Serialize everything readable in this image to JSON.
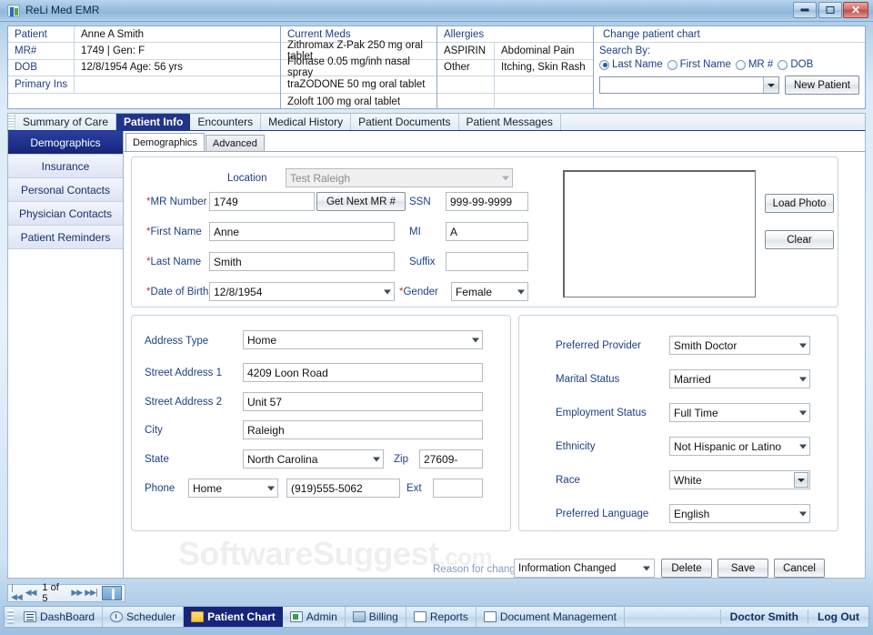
{
  "window": {
    "title": "ReLi Med EMR",
    "minimize": "–",
    "maximize": "❐",
    "close": "✕"
  },
  "patient_header": {
    "rows": [
      {
        "label": "Patient",
        "value": "Anne A Smith"
      },
      {
        "label": "MR#",
        "value": "1749 | Gen: F"
      },
      {
        "label": "DOB",
        "value": "12/8/1954  Age: 56 yrs"
      },
      {
        "label": "Primary Ins",
        "value": ""
      }
    ]
  },
  "current_meds": {
    "header": "Current Meds",
    "items": [
      "Zithromax Z-Pak 250 mg oral tablet",
      "Flonase 0.05 mg/inh nasal spray",
      "traZODONE 50 mg oral tablet",
      "Zoloft 100 mg oral tablet"
    ]
  },
  "allergies": {
    "header": "Allergies",
    "rows": [
      {
        "allergen": "ASPIRIN",
        "reaction": "Abdominal Pain"
      },
      {
        "allergen": "Other",
        "reaction": "Itching, Skin Rash"
      }
    ]
  },
  "change_patient_chart": {
    "title": "Change patient chart",
    "search_by_label": "Search By:",
    "options": [
      {
        "label": "Last Name",
        "selected": true
      },
      {
        "label": "First Name",
        "selected": false
      },
      {
        "label": "MR #",
        "selected": false
      },
      {
        "label": "DOB",
        "selected": false
      }
    ],
    "search_value": "",
    "new_patient_label": "New Patient"
  },
  "main_tabs": [
    {
      "label": "Summary of Care",
      "active": false
    },
    {
      "label": "Patient Info",
      "active": true
    },
    {
      "label": "Encounters",
      "active": false
    },
    {
      "label": "Medical History",
      "active": false
    },
    {
      "label": "Patient Documents",
      "active": false
    },
    {
      "label": "Patient Messages",
      "active": false
    }
  ],
  "sidebar": {
    "items": [
      {
        "label": "Demographics",
        "active": true
      },
      {
        "label": "Insurance",
        "active": false
      },
      {
        "label": "Personal Contacts",
        "active": false
      },
      {
        "label": "Physician Contacts",
        "active": false
      },
      {
        "label": "Patient Reminders",
        "active": false
      }
    ]
  },
  "sub_tabs": [
    {
      "label": "Demographics",
      "active": true
    },
    {
      "label": "Advanced",
      "active": false
    }
  ],
  "demographics": {
    "location_label": "Location",
    "location_value": "Test Raleigh",
    "mr_number_label": "MR Number",
    "mr_number_value": "1749",
    "get_next_mr_label": "Get Next MR #",
    "ssn_label": "SSN",
    "ssn_value": "999-99-9999",
    "first_name_label": "First Name",
    "first_name_value": "Anne",
    "mi_label": "MI",
    "mi_value": "A",
    "last_name_label": "Last Name",
    "last_name_value": "Smith",
    "suffix_label": "Suffix",
    "suffix_value": "",
    "dob_label": "Date of Birth",
    "dob_value": "12/8/1954",
    "gender_label": "Gender",
    "gender_value": "Female",
    "load_photo_label": "Load Photo",
    "clear_label": "Clear",
    "required_marker": "*"
  },
  "address": {
    "address_type_label": "Address Type",
    "address_type_value": "Home",
    "street1_label": "Street Address 1",
    "street1_value": "4209 Loon Road",
    "street2_label": "Street Address 2",
    "street2_value": "Unit 57",
    "city_label": "City",
    "city_value": "Raleigh",
    "state_label": "State",
    "state_value": "North Carolina",
    "zip_label": "Zip",
    "zip_value": "27609-",
    "phone_label": "Phone",
    "phone_type_value": "Home",
    "phone_value": "(919)555-5062",
    "ext_label": "Ext",
    "ext_value": ""
  },
  "details": {
    "preferred_provider_label": "Preferred Provider",
    "preferred_provider_value": "Smith Doctor",
    "marital_status_label": "Marital Status",
    "marital_status_value": "Married",
    "employment_status_label": "Employment  Status",
    "employment_status_value": "Full Time",
    "ethnicity_label": "Ethnicity",
    "ethnicity_value": "Not Hispanic or Latino",
    "race_label": "Race",
    "race_value": "White",
    "preferred_language_label": "Preferred Language",
    "preferred_language_value": "English"
  },
  "actions": {
    "reason_label": "Reason for change",
    "reason_value": "Information Changed",
    "delete_label": "Delete",
    "save_label": "Save",
    "cancel_label": "Cancel"
  },
  "record_nav": {
    "first": "|◀◀",
    "prev": "◀◀",
    "counter": "1 of 5",
    "next": "▶▶",
    "last": "▶▶|"
  },
  "taskbar": {
    "items": [
      {
        "label": "DashBoard",
        "icon": "list-icon",
        "active": false
      },
      {
        "label": "Scheduler",
        "icon": "clock-icon",
        "active": false
      },
      {
        "label": "Patient Chart",
        "icon": "folder-icon",
        "active": true
      },
      {
        "label": "Admin",
        "icon": "green-square-icon",
        "active": false
      },
      {
        "label": "Billing",
        "icon": "image-icon",
        "active": false
      },
      {
        "label": "Reports",
        "icon": "document-icon",
        "active": false
      },
      {
        "label": "Document Management",
        "icon": "page-icon",
        "active": false
      }
    ],
    "user": "Doctor Smith",
    "logout": "Log Out"
  },
  "watermark": {
    "text": "SoftwareSuggest",
    "suffix": ".com"
  }
}
